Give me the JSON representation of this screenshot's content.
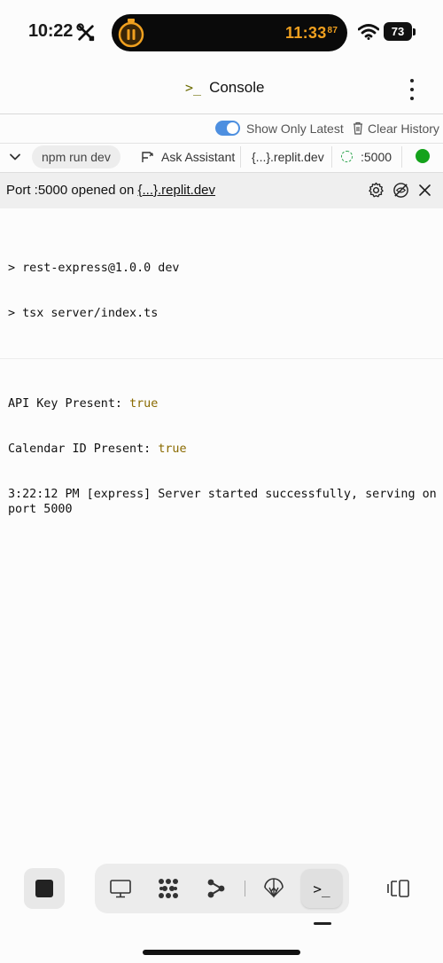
{
  "status_bar": {
    "time": "10:22",
    "timer_time": "11:33",
    "timer_fraction": "87",
    "battery": "73"
  },
  "header": {
    "icon": ">_",
    "title": "Console"
  },
  "options": {
    "show_only_latest": "Show Only Latest",
    "show_only_latest_on": true,
    "clear_history": "Clear History"
  },
  "toolbar": {
    "command": "npm run dev",
    "ask_assistant": "Ask Assistant",
    "domain": "{...}.replit.dev",
    "port": ":5000"
  },
  "port_bar": {
    "prefix": "Port :5000 opened on ",
    "link": "{...}.replit.dev"
  },
  "console": {
    "line1": "> rest-express@1.0.0 dev",
    "line2": "> tsx server/index.ts",
    "api_key_label": "API Key Present: ",
    "api_key_value": "true",
    "calendar_label": "Calendar ID Present: ",
    "calendar_value": "true",
    "server_line": "3:22:12 PM [express] Server started successfully, serving on port 5000"
  },
  "dock": {
    "active_icon": ">_"
  },
  "colors": {
    "accent_toggle": "#4d8fe0",
    "status_running": "#14a21b",
    "timer": "#f0a01f",
    "console_value": "#8a6a00"
  }
}
